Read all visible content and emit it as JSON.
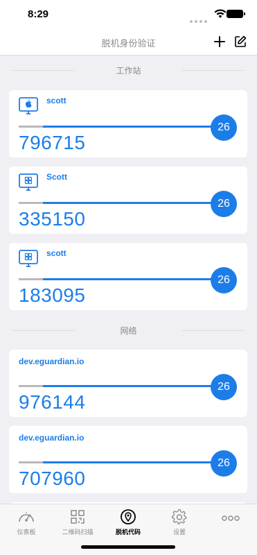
{
  "status": {
    "time": "8:29"
  },
  "nav": {
    "title": "脱机身份验证"
  },
  "sections": [
    {
      "label": "工作站"
    },
    {
      "label": "网络"
    }
  ],
  "cards": [
    {
      "account": "scott",
      "code": "796715",
      "seconds": "26",
      "icon": "apple-monitor-icon",
      "progress_elapsed": 0.12
    },
    {
      "account": "Scott",
      "code": "335150",
      "seconds": "26",
      "icon": "windows-monitor-icon",
      "progress_elapsed": 0.12
    },
    {
      "account": "scott",
      "code": "183095",
      "seconds": "26",
      "icon": "windows-monitor-icon",
      "progress_elapsed": 0.12
    },
    {
      "issuer": "dev.eguardian.io",
      "code": "976144",
      "seconds": "26",
      "progress_elapsed": 0.12
    },
    {
      "issuer": "dev.eguardian.io",
      "code": "707960",
      "seconds": "26",
      "progress_elapsed": 0.12
    }
  ],
  "tabs": [
    {
      "label": "仪表板",
      "icon": "gauge-icon"
    },
    {
      "label": "二维码扫描",
      "icon": "qr-code-icon"
    },
    {
      "label": "脱机代码",
      "icon": "offline-code-icon"
    },
    {
      "label": "设置",
      "icon": "gear-icon"
    },
    {
      "label": "",
      "icon": "more-icon"
    }
  ],
  "colors": {
    "accent": "#1c7de8",
    "muted": "#8a8a8a",
    "background": "#efeff4"
  }
}
